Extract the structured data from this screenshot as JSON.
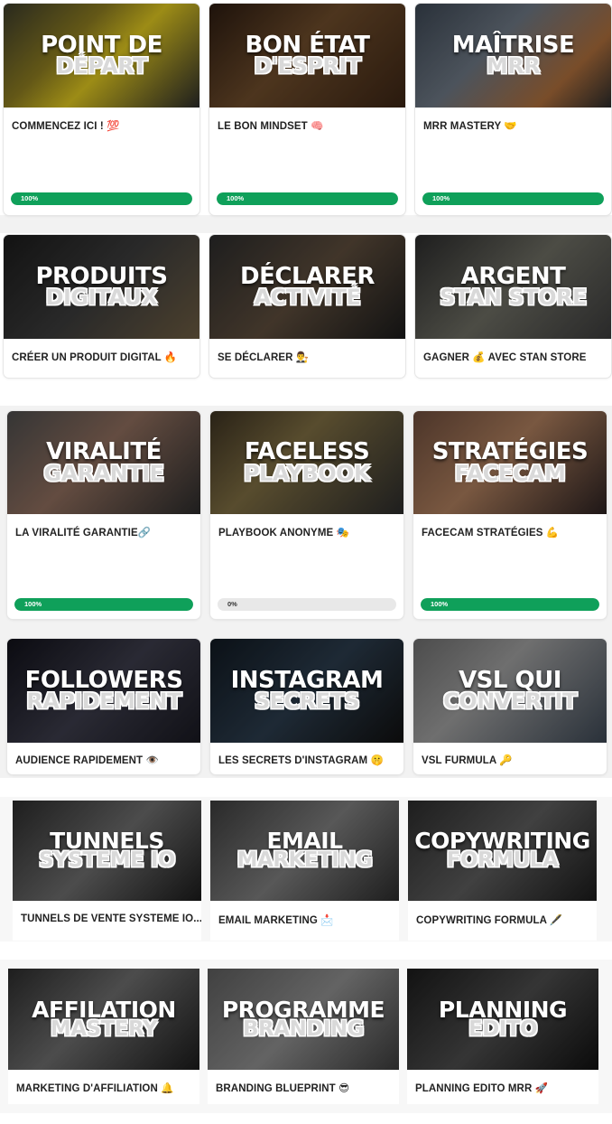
{
  "colors": {
    "progress_fill": "#0fa05a",
    "progress_track": "#e8e8e8",
    "title_text": "#222222"
  },
  "courses": [
    {
      "id": "point-de-depart",
      "line1": "POINT DE",
      "line2": "DÉPART",
      "title": "COMMENCEZ ICI ! 💯",
      "progress": 100,
      "progress_label": "100%",
      "bg": "linear-gradient(135deg,#3a3a2a 0%,#8a7a20 35%,#d9c21f 55%,#2a2a2a 100%)"
    },
    {
      "id": "bon-etat-d-esprit",
      "line1": "BON ÉTAT",
      "line2": "D'ESPRIT",
      "title": "LE BON MINDSET 🧠",
      "progress": 100,
      "progress_label": "100%",
      "bg": "linear-gradient(135deg,#2a1a10 0%,#6b4a2a 45%,#3a2414 100%)"
    },
    {
      "id": "maitrise-mrr",
      "line1": "MAÎTRISE",
      "line2": "MRR",
      "title": "MRR MASTERY 🤝",
      "progress": 100,
      "progress_label": "100%",
      "bg": "linear-gradient(135deg,#3a4450 0%,#6a7480 40%,#a86b3a 75%,#2a2a2a 100%)"
    },
    {
      "id": "produits-digitaux",
      "line1": "PRODUITS",
      "line2": "DIGITAUX",
      "title": "CRÉER UN PRODUIT DIGITAL 🔥",
      "progress": null,
      "progress_label": "",
      "bg": "linear-gradient(135deg,#1a1a1a 0%,#3a3a3a 50%,#6a5a40 100%)"
    },
    {
      "id": "declarer-activite",
      "line1": "DÉCLARER",
      "line2": "ACTIVITÉ",
      "title": "SE DÉCLARER 👨‍⚖️",
      "progress": null,
      "progress_label": "",
      "bg": "linear-gradient(135deg,#2a2a2a 0%,#5a4a3a 50%,#1a1a1a 100%)"
    },
    {
      "id": "argent-stan-store",
      "line1": "ARGENT",
      "line2": "STAN STORE",
      "title": "GAGNER 💰 AVEC STAN STORE",
      "progress": null,
      "progress_label": "",
      "bg": "linear-gradient(135deg,#2a2a2a 0%,#6a6a60 50%,#3a3a3a 100%)"
    },
    {
      "id": "viralite-garantie",
      "line1": "VIRALITÉ",
      "line2": "GARANTIE",
      "title": "LA VIRALITÉ GARANTIE🔗",
      "progress": 100,
      "progress_label": "100%",
      "bg": "linear-gradient(135deg,#4a4a4a 0%,#8a6a5a 45%,#2a2a2a 100%)"
    },
    {
      "id": "faceless-playbook",
      "line1": "FACELESS",
      "line2": "PLAYBOOK",
      "title": "PLAYBOOK ANONYME 🎭",
      "progress": 0,
      "progress_label": "0%",
      "bg": "linear-gradient(135deg,#3a3020 0%,#7a6a40 40%,#2a2a2a 100%)"
    },
    {
      "id": "strategies-facecam",
      "line1": "STRATÉGIES",
      "line2": "FACECAM",
      "title": "FACECAM STRATÉGIES 💪",
      "progress": 100,
      "progress_label": "100%",
      "bg": "linear-gradient(135deg,#6a4a3a 0%,#a87a5a 45%,#2a2020 100%)"
    },
    {
      "id": "followers-rapidement",
      "line1": "FOLLOWERS",
      "line2": "RAPIDEMENT",
      "title": "AUDIENCE RAPIDEMENT 👁️",
      "progress": null,
      "progress_label": "",
      "bg": "linear-gradient(135deg,#101018 0%,#3a3a48 50%,#181820 100%)"
    },
    {
      "id": "instagram-secrets",
      "line1": "INSTAGRAM",
      "line2": "SECRETS",
      "title": "LES SECRETS D'INSTAGRAM 🤫",
      "progress": null,
      "progress_label": "",
      "bg": "linear-gradient(135deg,#101820 0%,#2a3a4a 50%,#101010 100%)"
    },
    {
      "id": "vsl-qui-convertit",
      "line1": "VSL QUI",
      "line2": "CONVERTIT",
      "title": "VSL FURMULA 🔑",
      "progress": null,
      "progress_label": "",
      "bg": "linear-gradient(135deg,#6a6a6a 0%,#9a9a9a 40%,#3a4450 100%)"
    },
    {
      "id": "tunnels-systeme-io",
      "line1": "TUNNELS",
      "line2": "SYSTEME IO",
      "title": "TUNNELS DE VENTE SYSTEME IO...",
      "progress": null,
      "progress_label": "",
      "bg": "linear-gradient(135deg,#2a2a2a 0%,#6a6a6a 50%,#1a1a1a 100%)"
    },
    {
      "id": "email-marketing",
      "line1": "EMAIL",
      "line2": "MARKETING",
      "title": "EMAIL MARKETING 📩",
      "progress": null,
      "progress_label": "",
      "bg": "linear-gradient(135deg,#3a3a3a 0%,#7a7a7a 50%,#2a2a2a 100%)"
    },
    {
      "id": "copywriting-formula",
      "line1": "COPYWRITING",
      "line2": "FORMULA",
      "title": "COPYWRITING FORMULA 🖋️",
      "progress": null,
      "progress_label": "",
      "bg": "linear-gradient(135deg,#2a2a2a 0%,#5a5a5a 50%,#1a1a1a 100%)"
    },
    {
      "id": "affilation-mastery",
      "line1": "AFFILATION",
      "line2": "MASTERY",
      "title": "MARKETING D'AFFILIATION 🔔",
      "progress": null,
      "progress_label": "",
      "bg": "linear-gradient(135deg,#2a2a2a 0%,#6a6a6a 45%,#1a1a1a 100%)"
    },
    {
      "id": "programme-branding",
      "line1": "PROGRAMME",
      "line2": "BRANDING",
      "title": "BRANDING BLUEPRINT 😎",
      "progress": null,
      "progress_label": "",
      "bg": "linear-gradient(135deg,#5a5a5a 0%,#8a8a8a 50%,#3a3a3a 100%)"
    },
    {
      "id": "planning-edito",
      "line1": "PLANNING",
      "line2": "EDITO",
      "title": "PLANNING EDITO MRR 🚀",
      "progress": null,
      "progress_label": "",
      "bg": "linear-gradient(135deg,#1a1a1a 0%,#4a4a4a 50%,#101010 100%)"
    }
  ]
}
